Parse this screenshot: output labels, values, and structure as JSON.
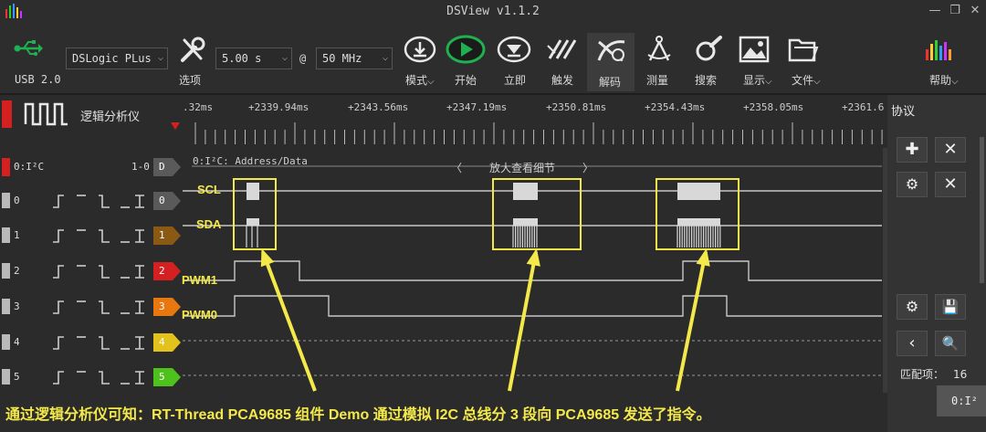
{
  "window": {
    "title": "DSView v1.1.2"
  },
  "toolbar": {
    "usb_label": "USB 2.0",
    "device": "DSLogic PLus",
    "options_label": "选项",
    "duration": "5.00 s",
    "at": "@",
    "rate": "50 MHz",
    "mode_label": "模式",
    "start_label": "开始",
    "instant_label": "立即",
    "trigger_label": "触发",
    "decode_label": "解码",
    "measure_label": "测量",
    "search_label": "搜索",
    "display_label": "显示",
    "file_label": "文件",
    "help_label": "帮助"
  },
  "channels": {
    "header_title": "逻辑分析仪",
    "decoder": {
      "id": "0:I²C",
      "range": "1-0",
      "tag": "D",
      "label": "0:I²C: Address/Data"
    },
    "list": [
      {
        "num": "0",
        "trig": "_┌ ‾ ┐_ _ ⌑",
        "tag": "0",
        "color": "#5a5a5a"
      },
      {
        "num": "1",
        "trig": "_┌ ‾ ┐_ _ ⌑",
        "tag": "1",
        "color": "#8a5a14"
      },
      {
        "num": "2",
        "trig": "_┌ ‾ ┐_ _ ⌑",
        "tag": "2",
        "color": "#d42020"
      },
      {
        "num": "3",
        "trig": "_┌ ‾ ┐_ _ ⌑",
        "tag": "3",
        "color": "#e8770f"
      },
      {
        "num": "4",
        "trig": "_┌ ‾ ┐_ _ ⌑",
        "tag": "4",
        "color": "#e3c21c"
      },
      {
        "num": "5",
        "trig": "_┌ ‾ ┐_ _ ⌑",
        "tag": "5",
        "color": "#4ec21c"
      }
    ]
  },
  "ruler": {
    "ticks": [
      ".32ms",
      "+2339.94ms",
      "+2343.56ms",
      "+2347.19ms",
      "+2350.81ms",
      "+2354.43ms",
      "+2358.05ms",
      "+2361.6"
    ]
  },
  "annotations": {
    "zoom_hint": "放大查看细节",
    "scl": "SCL",
    "sda": "SDA",
    "pwm1": "PWM1",
    "pwm0": "PWM0",
    "caption": "通过逻辑分析仪可知：RT-Thread PCA9685 组件 Demo 通过模拟 I2C 总线分 3 段向 PCA9685 发送了指令。"
  },
  "right_panel": {
    "title": "协议",
    "match_label": "匹配项：",
    "match_value": "16",
    "row_value": "0:I²"
  },
  "colors": {
    "accent_green": "#1fb050",
    "highlight": "#f4e94a",
    "signal": "#c8c8c8"
  }
}
